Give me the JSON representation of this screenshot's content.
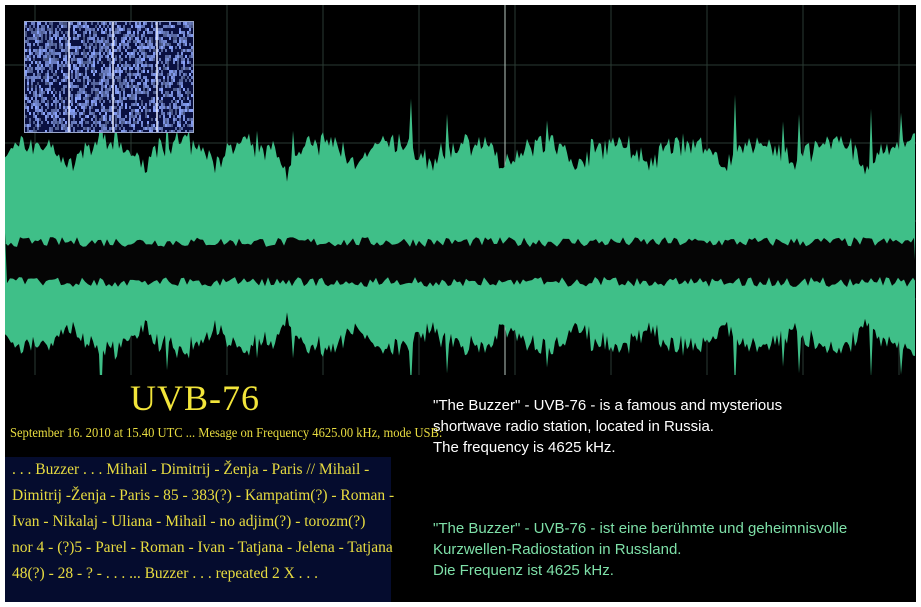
{
  "colors": {
    "background": "#000000",
    "waveform": "#3fbf88",
    "grid": "#2a3a33",
    "title": "#f2e53a",
    "yellow_text": "#e8dc40",
    "english_text": "#ffffff",
    "german_text": "#7ee0a8",
    "message_panel": "#050c2e"
  },
  "icons": {
    "spectrogram": "spectrogram-thumbnail",
    "waveform": "audio-waveform"
  },
  "title": "UVB-76",
  "subtitle": "September 16. 2010 at 15.40 UTC ... Mesage on Frequency 4625.00 kHz,  mode USB:",
  "message_lines": [
    ". . .  Buzzer . . .     Mihail - Dimitrij - Ženja - Paris // Mihail -",
    "Dimitrij -Ženja - Paris - 85 - 383(?) - Kampatim(?) - Roman -",
    "Ivan - Nikalaj - Uliana - Mihail - no adjim(?) - torozm(?)",
    "nor 4 - (?)5 - Parel - Roman - Ivan - Tatjana - Jelena - Tatjana",
    "48(?) - 28 - ? - . . .     ...  Buzzer . . .   repeated   2 X . . ."
  ],
  "description_en": [
    "\"The Buzzer\" - UVB-76 - is a famous and mysterious",
    "shortwave radio station, located in Russia.",
    "The frequency is 4625 kHz."
  ],
  "description_de": [
    "\"The Buzzer\" - UVB-76 - ist eine berühmte und geheimnisvolle",
    "Kurzwellen-Radiostation in Russland.",
    "Die Frequenz ist 4625 kHz."
  ]
}
